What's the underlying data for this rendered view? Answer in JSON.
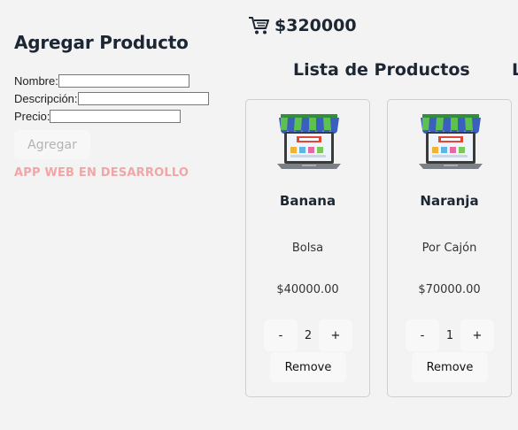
{
  "form": {
    "title": "Agregar Producto",
    "fields": [
      {
        "label": "Nombre:",
        "value": ""
      },
      {
        "label": "Descripción:",
        "value": ""
      },
      {
        "label": "Precio:",
        "value": ""
      }
    ],
    "submit_label": "Agregar",
    "dev_note": "APP WEB EN DESARROLLO"
  },
  "cart": {
    "icon": "cart-icon",
    "total": "$320000"
  },
  "list": {
    "title": "Lista de Productos",
    "next_title_fragment": "L"
  },
  "products": [
    {
      "image_icon": "online-store-icon",
      "name": "Banana",
      "description": "Bolsa",
      "price": "$40000.00",
      "qty": "2",
      "minus": "-",
      "plus": "+",
      "remove_label": "Remove"
    },
    {
      "image_icon": "online-store-icon",
      "name": "Naranja",
      "description": "Por Cajón",
      "price": "$70000.00",
      "qty": "1",
      "minus": "-",
      "plus": "+",
      "remove_label": "Remove"
    }
  ],
  "colors": {
    "heading": "#1c2733",
    "dev_note": "#f3a5a5",
    "background": "#f3f3f3"
  }
}
